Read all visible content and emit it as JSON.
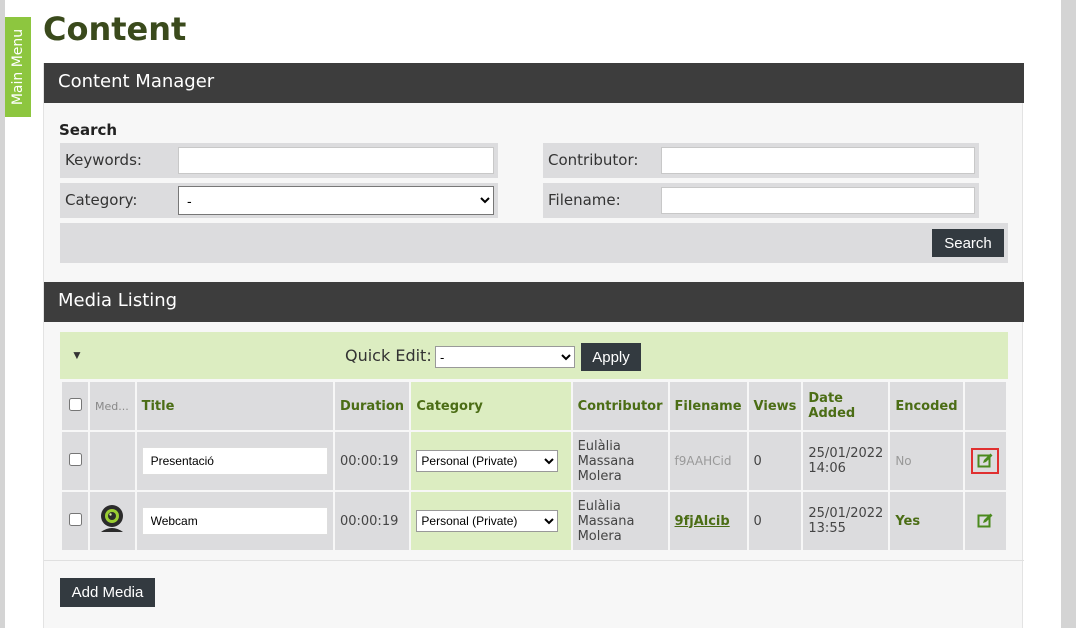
{
  "sidebar": {
    "main_menu_label": "Main Menu"
  },
  "page": {
    "title": "Content"
  },
  "content_manager": {
    "header": "Content Manager",
    "search_heading": "Search",
    "keywords_label": "Keywords:",
    "keywords_value": "",
    "category_label": "Category:",
    "category_value": "-",
    "contributor_label": "Contributor:",
    "contributor_value": "",
    "filename_label": "Filename:",
    "filename_value": "",
    "search_button": "Search"
  },
  "media_listing": {
    "header": "Media Listing",
    "toggle_glyph": "▼",
    "quick_edit_label": "Quick Edit:",
    "quick_edit_value": "-",
    "apply_button": "Apply",
    "columns": {
      "media": "Med...",
      "title": "Title",
      "duration": "Duration",
      "category": "Category",
      "contributor": "Contributor",
      "filename": "Filename",
      "views": "Views",
      "date_added": "Date Added",
      "encoded": "Encoded"
    },
    "rows": [
      {
        "title": "Presentació",
        "duration": "00:00:19",
        "category": "Personal (Private)",
        "contributor": "Eulàlia Massana Molera",
        "filename": "f9AAHCid",
        "views": "0",
        "date_added": "25/01/2022 14:06",
        "encoded": "No"
      },
      {
        "title": "Webcam",
        "duration": "00:00:19",
        "category": "Personal (Private)",
        "contributor": "Eulàlia Massana Molera",
        "filename": "9fjAlcib",
        "views": "0",
        "date_added": "25/01/2022 13:55",
        "encoded": "Yes"
      }
    ],
    "add_media_button": "Add Media"
  },
  "colors": {
    "accent_green": "#8dc63f",
    "header_dark": "#3d3d3d",
    "link_green": "#4b6d15",
    "highlight_red": "#e03030"
  }
}
